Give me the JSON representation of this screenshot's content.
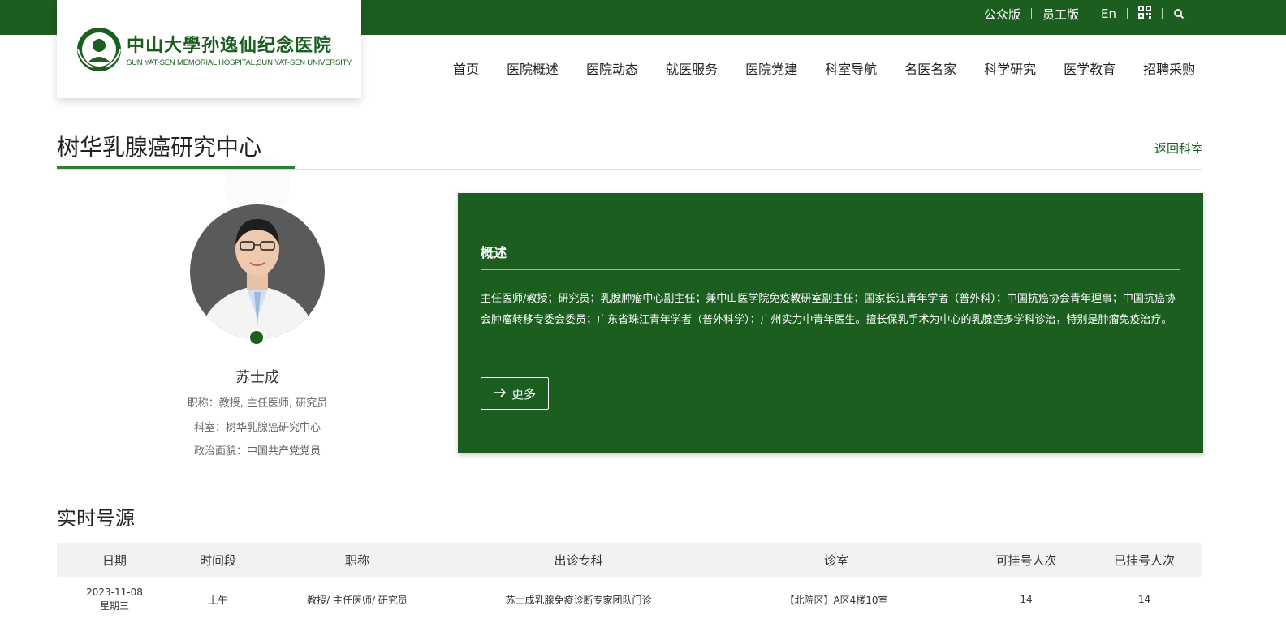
{
  "header": {
    "util_links": [
      {
        "label": "公众版"
      },
      {
        "label": "员工版"
      },
      {
        "label": "En"
      }
    ],
    "logo": {
      "cn": "中山大學孙逸仙纪念医院",
      "en": "SUN YAT-SEN MEMORIAL HOSPITAL,SUN YAT-SEN UNIVERSITY"
    },
    "nav": [
      "首页",
      "医院概述",
      "医院动态",
      "就医服务",
      "医院党建",
      "科室导航",
      "名医名家",
      "科学研究",
      "医学教育",
      "招聘采购"
    ]
  },
  "page": {
    "title": "树华乳腺癌研究中心",
    "back_link": "返回科室"
  },
  "doctor": {
    "name": "苏士成",
    "title_line": "职称：教授, 主任医师, 研究员",
    "dept_line": "科室：树华乳腺癌研究中心",
    "politics_line": "政治面貌：中国共产党党员"
  },
  "summary": {
    "heading": "概述",
    "text": "主任医师/教授；研究员；乳腺肿瘤中心副主任；兼中山医学院免疫教研室副主任；国家长江青年学者（普外科）；中国抗癌协会青年理事；中国抗癌协会肿瘤转移专委会委员；广东省珠江青年学者（普外科学）；广州实力中青年医生。擅长保乳手术为中心的乳腺癌多学科诊治，特别是肿瘤免疫治疗。",
    "more_label": "更多"
  },
  "schedule": {
    "title": "实时号源",
    "headers": [
      "日期",
      "时间段",
      "职称",
      "出诊专科",
      "诊室",
      "可挂号人次",
      "已挂号人次"
    ],
    "rows": [
      {
        "date": "2023-11-08",
        "weekday": "星期三",
        "period": "上午",
        "title": "教授/ 主任医师/ 研究员",
        "specialty": "苏士成乳腺免疫诊断专家团队门诊",
        "room": "【北院区】A区4楼10室",
        "available": "14",
        "booked": "14"
      }
    ]
  },
  "colors": {
    "brand_green": "#1b5e20",
    "accent_green": "#2e7d32"
  },
  "icons": [
    "qr-code-icon",
    "search-icon",
    "arrow-right-icon",
    "hospital-emblem-icon"
  ]
}
